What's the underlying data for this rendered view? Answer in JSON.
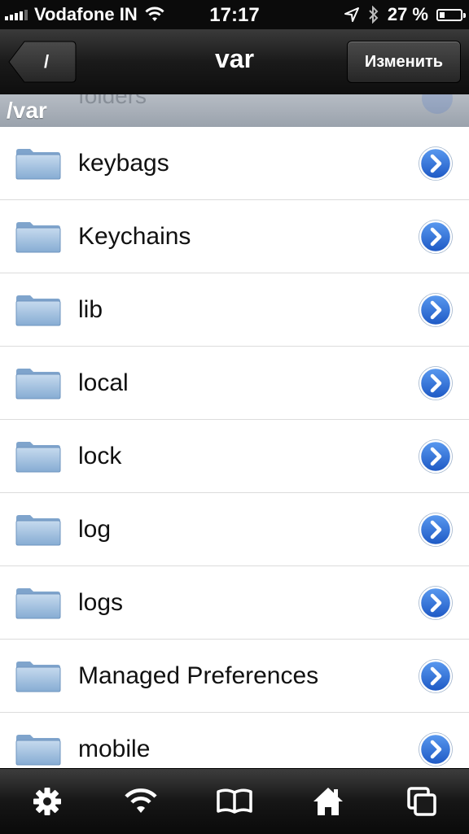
{
  "status_bar": {
    "carrier": "Vodafone IN",
    "time": "17:17",
    "battery_percent": "27 %",
    "battery_level": 0.27,
    "signal_bars": 4
  },
  "nav": {
    "back_label": "/",
    "title": "var",
    "edit_label": "Изменить"
  },
  "path": {
    "label": "/var",
    "ghost_text": "folders"
  },
  "items": [
    {
      "label": "keybags"
    },
    {
      "label": "Keychains"
    },
    {
      "label": "lib"
    },
    {
      "label": "local"
    },
    {
      "label": "lock"
    },
    {
      "label": "log"
    },
    {
      "label": "logs"
    },
    {
      "label": "Managed Preferences"
    },
    {
      "label": "mobile"
    }
  ],
  "toolbar": {
    "icons": [
      "gear-icon",
      "wifi-icon",
      "book-icon",
      "home-icon",
      "windows-icon"
    ]
  },
  "colors": {
    "folder": "#9dc0e0",
    "disclosure": "#2f6fd0",
    "nav_bg": "#1a1a1a"
  }
}
